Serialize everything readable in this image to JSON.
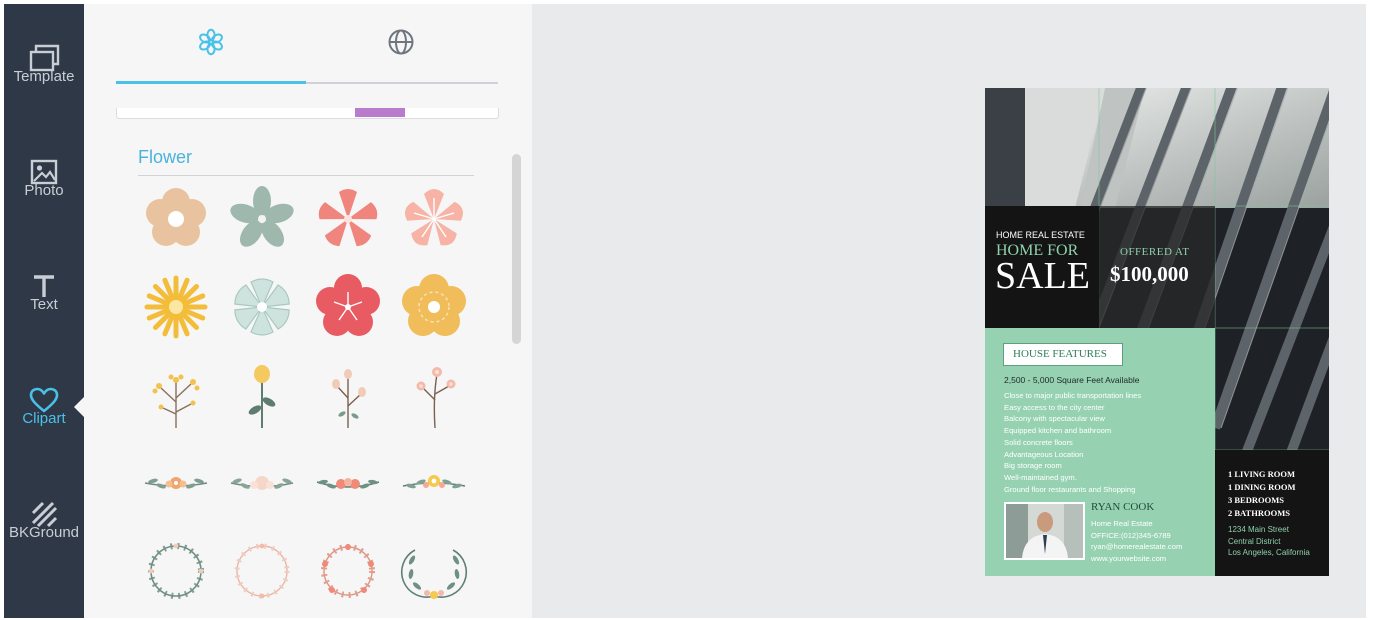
{
  "nav": {
    "items": [
      {
        "label": "Template",
        "icon": "template-icon"
      },
      {
        "label": "Photo",
        "icon": "photo-icon"
      },
      {
        "label": "Text",
        "icon": "text-icon"
      },
      {
        "label": "Clipart",
        "icon": "heart-icon",
        "active": true
      },
      {
        "label": "BKGround",
        "icon": "background-icon"
      }
    ]
  },
  "panel": {
    "tabs": [
      {
        "icon": "flower-icon",
        "active": true
      },
      {
        "icon": "globe-icon",
        "active": false
      }
    ],
    "category": "Flower",
    "clipart_count": 20
  },
  "colors": {
    "nav_bg": "#2e3846",
    "accent": "#49c1e8",
    "panel_bg": "#f6f6f6",
    "canvas_bg": "#e9eaeb",
    "flyer_green": "#96d2b2",
    "flyer_dark": "#1b1b1c"
  },
  "flyer": {
    "eyebrow": "HOME REAL ESTATE",
    "headline_small": "HOME FOR",
    "headline_big": "SALE",
    "offered_label": "OFFERED AT",
    "price": "$100,000",
    "features_title": "HOUSE FEATURES",
    "features_lead": "2,500 - 5,000 Square Feet Available",
    "features": [
      "Close to major public transportation lines",
      "Easy access to the city center",
      "Balcony with spectacular view",
      "Equipped kitchen and bathroom",
      "Solid concrete floors",
      "Advantageous Location",
      "Big storage room",
      "Well-maintained gym.",
      "Ground floor restaurants and Shopping"
    ],
    "rooms": [
      "1 LIVING ROOM",
      "1 DINING ROOM",
      "3 BEDROOMS",
      "2 BATHROOMS"
    ],
    "address": [
      "1234 Main Street",
      "Central District",
      "Los Angeles, California"
    ],
    "agent": {
      "name": "RYAN COOK",
      "lines": [
        "Home Real Estate",
        "OFFICE:(012)345-6789",
        "ryan@homerealestate.com",
        "www.yourwebsite.com"
      ]
    }
  }
}
